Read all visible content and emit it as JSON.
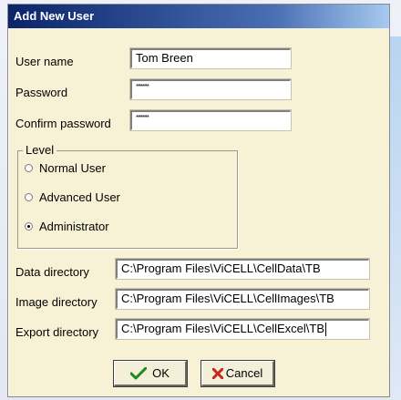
{
  "window": {
    "title": "Add New User"
  },
  "form": {
    "user_name_label": "User name",
    "user_name_value": "Tom Breen",
    "password_label": "Password",
    "password_mask": "********",
    "confirm_password_label": "Confirm password",
    "confirm_password_mask": "********"
  },
  "level": {
    "legend": "Level",
    "options": [
      {
        "label": "Normal User",
        "checked": false
      },
      {
        "label": "Advanced User",
        "checked": false
      },
      {
        "label": "Administrator",
        "checked": true
      }
    ]
  },
  "directories": {
    "data_label": "Data directory",
    "data_value": "C:\\Program Files\\ViCELL\\CellData\\TB",
    "image_label": "Image directory",
    "image_value": "C:\\Program Files\\ViCELL\\CellImages\\TB",
    "export_label": "Export directory",
    "export_value": "C:\\Program Files\\ViCELL\\CellExcel\\TB"
  },
  "buttons": {
    "ok_label": "OK",
    "cancel_label": "Cancel"
  },
  "colors": {
    "dialog_bg": "#f7f2d6",
    "titlebar": "#0a246a",
    "ok_icon": "#1e8a1e",
    "cancel_icon": "#c8261e"
  },
  "icons": {
    "ok": "checkmark-icon",
    "cancel": "x-icon"
  }
}
